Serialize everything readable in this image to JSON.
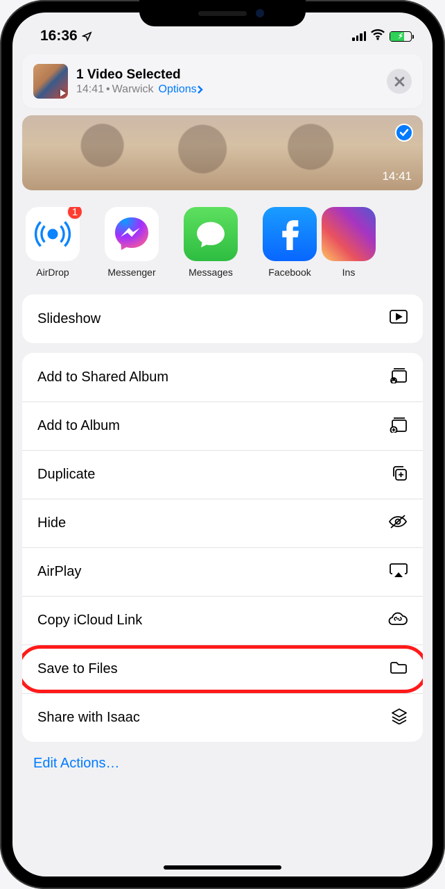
{
  "statusbar": {
    "time": "16:36"
  },
  "header": {
    "title": "1 Video Selected",
    "timestamp": "14:41",
    "location": "Warwick",
    "options_label": "Options"
  },
  "preview": {
    "duration": "14:41"
  },
  "share_apps": [
    {
      "label": "AirDrop",
      "badge": "1"
    },
    {
      "label": "Messenger"
    },
    {
      "label": "Messages"
    },
    {
      "label": "Facebook"
    },
    {
      "label": "Ins"
    }
  ],
  "action_group1": [
    {
      "label": "Slideshow"
    }
  ],
  "action_group2": [
    {
      "label": "Add to Shared Album"
    },
    {
      "label": "Add to Album"
    },
    {
      "label": "Duplicate"
    },
    {
      "label": "Hide"
    },
    {
      "label": "AirPlay"
    },
    {
      "label": "Copy iCloud Link"
    },
    {
      "label": "Save to Files"
    },
    {
      "label": "Share with Isaac"
    }
  ],
  "edit_actions": "Edit Actions…"
}
